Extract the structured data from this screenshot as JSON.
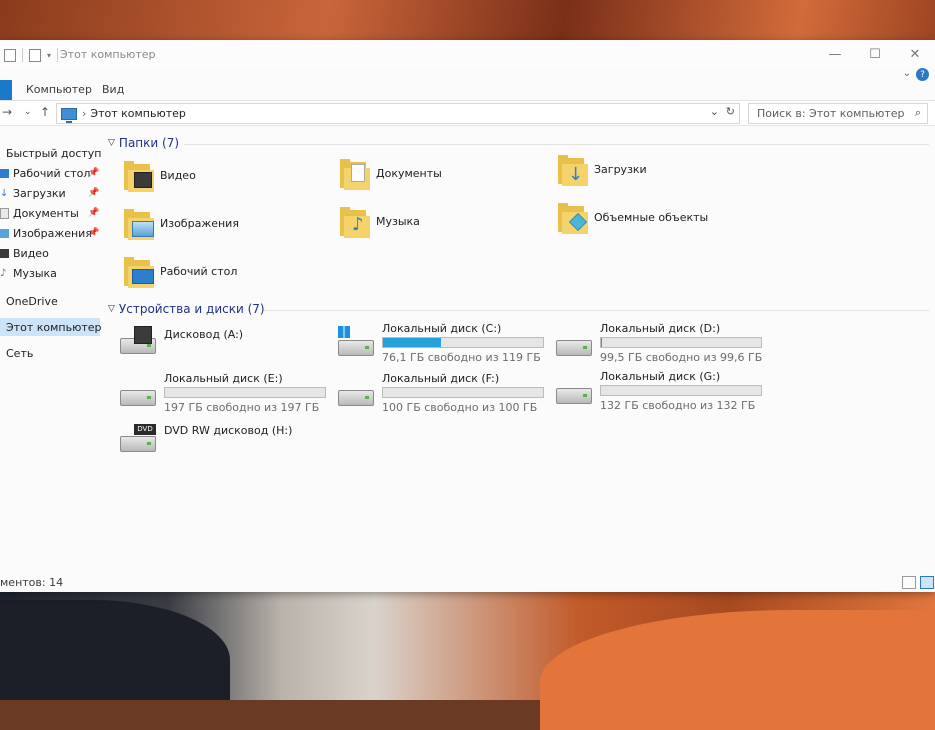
{
  "window": {
    "title": "Этот компьютер",
    "controls": {
      "minimize": "—",
      "maximize": "☐",
      "close": "✕"
    }
  },
  "ribbon": {
    "tabs": [
      "Компьютер",
      "Вид"
    ],
    "help": "?"
  },
  "address": {
    "path": "Этот компьютер",
    "search_placeholder": "Поиск в: Этот компьютер"
  },
  "nav_pane": [
    {
      "label": "Быстрый доступ",
      "icon": "star-icon"
    },
    {
      "label": "Рабочий стол",
      "icon": "desktop-icon",
      "pinned": true
    },
    {
      "label": "Загрузки",
      "icon": "downloads-icon",
      "pinned": true
    },
    {
      "label": "Документы",
      "icon": "documents-icon",
      "pinned": true
    },
    {
      "label": "Изображения",
      "icon": "pictures-icon",
      "pinned": true
    },
    {
      "label": "Видео",
      "icon": "video-icon"
    },
    {
      "label": "Музыка",
      "icon": "music-icon"
    },
    {
      "label": "OneDrive",
      "icon": "cloud-icon"
    },
    {
      "label": "Этот компьютер",
      "icon": "computer-icon",
      "selected": true
    },
    {
      "label": "Сеть",
      "icon": "network-icon"
    }
  ],
  "folders_section": {
    "header": "Папки (7)",
    "items": [
      {
        "label": "Видео",
        "icon": "video-folder-icon"
      },
      {
        "label": "Документы",
        "icon": "documents-folder-icon"
      },
      {
        "label": "Загрузки",
        "icon": "downloads-folder-icon"
      },
      {
        "label": "Изображения",
        "icon": "pictures-folder-icon"
      },
      {
        "label": "Музыка",
        "icon": "music-folder-icon"
      },
      {
        "label": "Объемные объекты",
        "icon": "3d-objects-folder-icon"
      },
      {
        "label": "Рабочий стол",
        "icon": "desktop-folder-icon"
      }
    ]
  },
  "drives_section": {
    "header": "Устройства и диски (7)",
    "items": [
      {
        "label": "Дисковод (A:)",
        "icon": "floppy-drive-icon"
      },
      {
        "label": "Локальный диск (C:)",
        "free": "76,1 ГБ свободно из 119 ГБ",
        "used_fraction": 0.36,
        "icon": "windows-drive-icon"
      },
      {
        "label": "Локальный диск (D:)",
        "free": "99,5 ГБ свободно из 99,6 ГБ",
        "used_fraction": 0.001,
        "icon": "hard-drive-icon"
      },
      {
        "label": "Локальный диск (E:)",
        "free": "197 ГБ свободно из 197 ГБ",
        "used_fraction": 0.0,
        "icon": "hard-drive-icon"
      },
      {
        "label": "Локальный диск (F:)",
        "free": "100 ГБ свободно из 100 ГБ",
        "used_fraction": 0.0,
        "icon": "hard-drive-icon"
      },
      {
        "label": "Локальный диск (G:)",
        "free": "132 ГБ свободно из 132 ГБ",
        "used_fraction": 0.0,
        "icon": "hard-drive-icon"
      },
      {
        "label": "DVD RW дисковод (H:)",
        "icon": "dvd-drive-icon"
      }
    ]
  },
  "status": {
    "text": "ментов: 14"
  },
  "colors": {
    "accent": "#1979ca",
    "selection": "#cce4f7",
    "drive_bar": "#26a0da",
    "folder": "#e8c04a"
  }
}
